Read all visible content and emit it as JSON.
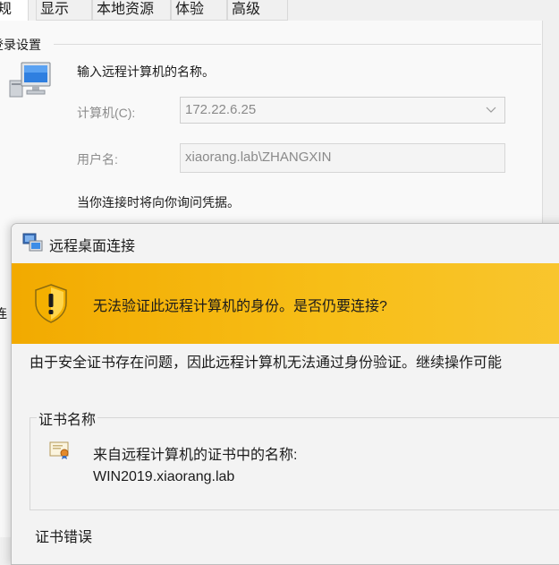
{
  "tabs": [
    {
      "label": "规",
      "active": true
    },
    {
      "label": "显示",
      "active": false
    },
    {
      "label": "本地资源",
      "active": false
    },
    {
      "label": "体验",
      "active": false
    },
    {
      "label": "高级",
      "active": false
    }
  ],
  "login_settings": {
    "group_label": "登录设置",
    "prompt": "输入远程计算机的名称。",
    "computer_label": "计算机(C):",
    "computer_value": "172.22.6.25",
    "username_label": "用户名:",
    "username_value": "xiaorang.lab\\ZHANGXIN",
    "credential_note": "当你连接时将向你询问凭据。",
    "partial_left_text": "连"
  },
  "dialog": {
    "title": "远程桌面连接",
    "warning": "无法验证此远程计算机的身份。是否仍要连接?",
    "description": "由于安全证书存在问题，因此远程计算机无法通过身份验证。继续操作可能",
    "cert_group_label": "证书名称",
    "cert_name_caption": "来自远程计算机的证书中的名称:",
    "cert_name_value": "WIN2019.xiaorang.lab",
    "cert_errors_label": "证书错误"
  },
  "colors": {
    "warning_bar": "#f7be17",
    "dialog_bg": "#f3f3f3",
    "panel_bg": "#f9f9f9"
  },
  "icons": {
    "monitor": "computer-monitor-icon",
    "title": "remote-desktop-icon",
    "warning": "warning-shield-icon",
    "certificate": "certificate-icon",
    "dropdown": "chevron-down-icon"
  }
}
